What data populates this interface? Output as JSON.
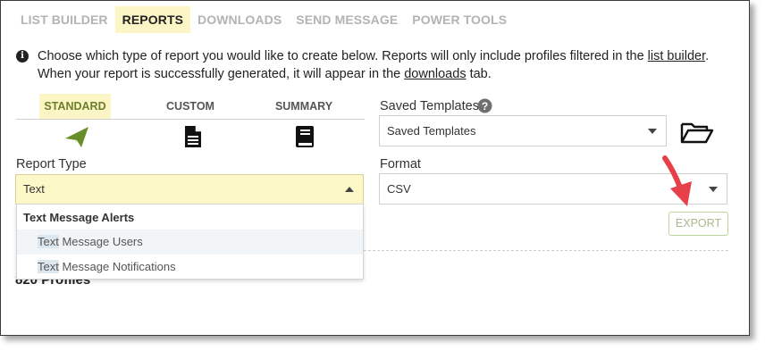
{
  "nav": {
    "tabs": [
      {
        "label": "LIST BUILDER",
        "active": false
      },
      {
        "label": "REPORTS",
        "active": true
      },
      {
        "label": "DOWNLOADS",
        "active": false
      },
      {
        "label": "SEND MESSAGE",
        "active": false
      },
      {
        "label": "POWER TOOLS",
        "active": false
      }
    ]
  },
  "info": {
    "icon": "info-icon",
    "line1_pre": "Choose which type of report you would like to create below. Reports will only include profiles filtered in the ",
    "line1_link": "list builder",
    "line1_post": ".",
    "line2_pre": "When your report is successfully generated, it will appear in the ",
    "line2_link": "downloads",
    "line2_post": " tab."
  },
  "report_tabs": [
    {
      "label": "STANDARD",
      "icon": "paper-plane-icon",
      "active": true
    },
    {
      "label": "CUSTOM",
      "icon": "document-icon",
      "active": false
    },
    {
      "label": "SUMMARY",
      "icon": "book-icon",
      "active": false
    }
  ],
  "saved_templates": {
    "label": "Saved Templates",
    "help_icon": "question-circle-icon",
    "value": "Saved Templates",
    "open_icon": "folder-open-icon"
  },
  "report_type": {
    "label": "Report Type",
    "value": "Text",
    "dropdown": {
      "group": "Text Message Alerts",
      "items": [
        {
          "match": "Text",
          "rest": " Message Users"
        },
        {
          "match": "Text",
          "rest": " Message Notifications"
        }
      ]
    }
  },
  "format": {
    "label": "Format",
    "value": "CSV"
  },
  "export_label": "EXPORT",
  "profiles_text": "820 Profiles",
  "colors": {
    "active_tab_bg": "#fcf6c6",
    "accent_green": "#6b7f2a",
    "arrow_red": "#e8404a"
  }
}
